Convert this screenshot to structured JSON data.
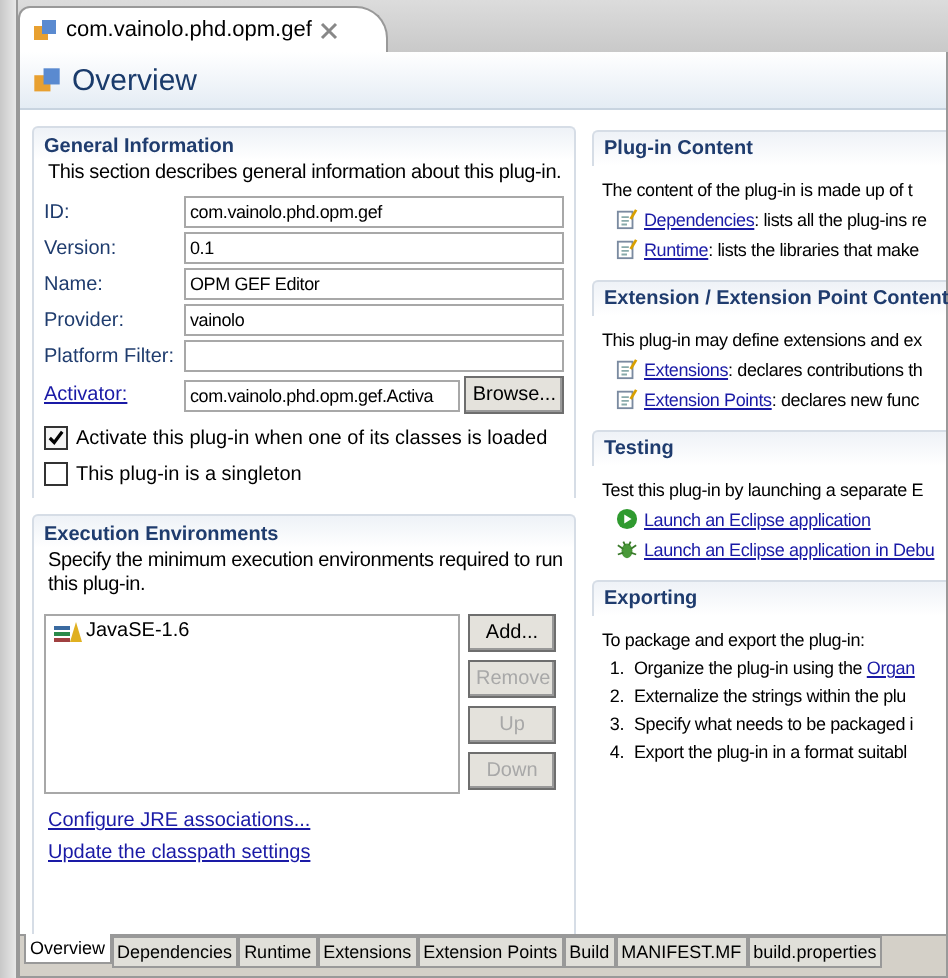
{
  "editor_tab": {
    "title": "com.vainolo.phd.opm.gef"
  },
  "header": {
    "title": "Overview"
  },
  "general": {
    "title": "General Information",
    "description": "This section describes general information about this plug-in.",
    "fields": [
      {
        "label": "ID:",
        "value": "com.vainolo.phd.opm.gef",
        "link": false
      },
      {
        "label": "Version:",
        "value": "0.1",
        "link": false
      },
      {
        "label": "Name:",
        "value": "OPM GEF Editor",
        "link": false
      },
      {
        "label": "Provider:",
        "value": "vainolo",
        "link": false
      },
      {
        "label": "Platform Filter:",
        "link": false
      },
      {
        "label": "Activator:",
        "value": "com.vainolo.phd.opm.gef.Activa",
        "link": true,
        "button": "Browse..."
      }
    ],
    "checkboxes": [
      {
        "label": "Activate this plug-in when one of its classes is loaded",
        "checked": true
      },
      {
        "label": "This plug-in is a singleton",
        "checked": false
      }
    ]
  },
  "execution": {
    "title": "Execution Environments",
    "description": "Specify the minimum execution environments required to run this plug-in.",
    "items": [
      "JavaSE-1.6"
    ],
    "buttons": [
      {
        "label": "Add...",
        "disabled": false
      },
      {
        "label": "Remove",
        "disabled": true
      },
      {
        "label": "Up",
        "disabled": true
      },
      {
        "label": "Down",
        "disabled": true
      }
    ],
    "links": [
      "Configure JRE associations...",
      "Update the classpath settings"
    ]
  },
  "right_sections": [
    {
      "title": "Plug-in Content",
      "description": "The content of the plug-in is made up of t",
      "items": [
        {
          "kind": "page",
          "link": "Dependencies",
          "text": ": lists all the plug-ins re"
        },
        {
          "kind": "page",
          "link": "Runtime",
          "text": ": lists the libraries that make"
        }
      ]
    },
    {
      "title": "Extension / Extension Point Content",
      "description": "This plug-in may define extensions and ex",
      "items": [
        {
          "kind": "page",
          "link": "Extensions",
          "text": ": declares contributions th"
        },
        {
          "kind": "page",
          "link": "Extension Points",
          "text": ": declares new func"
        }
      ]
    },
    {
      "title": "Testing",
      "description": "Test this plug-in by launching a separate E",
      "items": [
        {
          "kind": "run",
          "link": "Launch an Eclipse application"
        },
        {
          "kind": "debug",
          "link": "Launch an Eclipse application in Debu"
        }
      ]
    },
    {
      "title": "Exporting",
      "description": "To package and export the plug-in:",
      "items": [
        {
          "kind": "step",
          "number": "1.",
          "text": "Organize the plug-in using the ",
          "link": "Organ"
        },
        {
          "kind": "step",
          "number": "2.",
          "text": "Externalize the strings within the plu"
        },
        {
          "kind": "step",
          "number": "3.",
          "text": "Specify what needs to be packaged i"
        },
        {
          "kind": "step",
          "number": "4.",
          "text": "Export the plug-in in a format suitabl"
        }
      ]
    }
  ],
  "bottom_tabs": [
    {
      "label": "Overview",
      "selected": true
    },
    {
      "label": "Dependencies",
      "selected": false
    },
    {
      "label": "Runtime",
      "selected": false
    },
    {
      "label": "Extensions",
      "selected": false
    },
    {
      "label": "Extension Points",
      "selected": false
    },
    {
      "label": "Build",
      "selected": false
    },
    {
      "label": "MANIFEST.MF",
      "selected": false
    },
    {
      "label": "build.properties",
      "selected": false
    }
  ]
}
